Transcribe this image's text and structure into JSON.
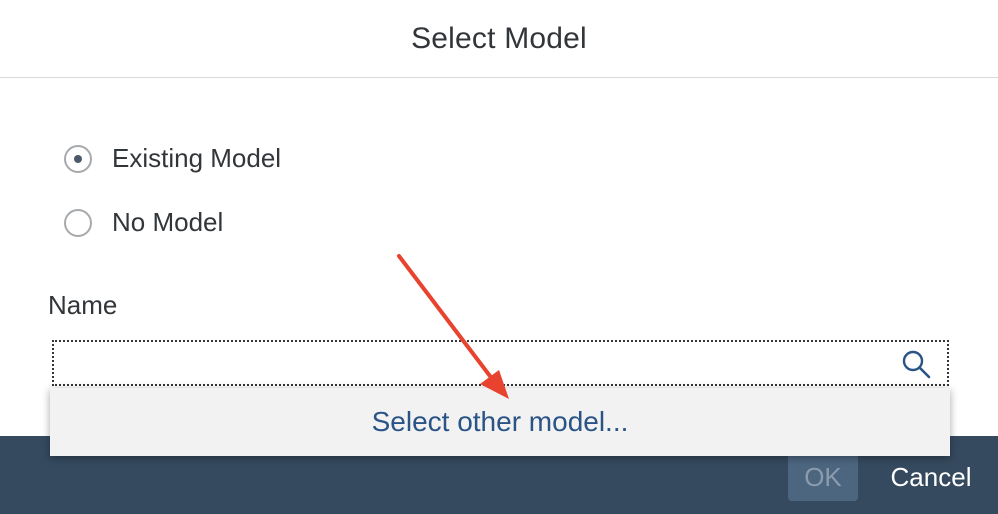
{
  "dialog": {
    "title": "Select Model"
  },
  "radio_options": [
    {
      "label": "Existing Model",
      "selected": true
    },
    {
      "label": "No Model",
      "selected": false
    }
  ],
  "name_field": {
    "label": "Name",
    "value": "",
    "icon": "search-icon"
  },
  "suggestion": {
    "text": "Select other model..."
  },
  "footer": {
    "ok_label": "OK",
    "cancel_label": "Cancel"
  },
  "colors": {
    "footer_bg": "#354a5f",
    "annotation_arrow": "#e8432f",
    "link_text": "#2a5486"
  }
}
